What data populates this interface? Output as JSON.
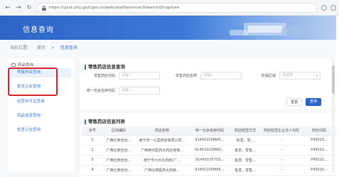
{
  "browser": {
    "url": "https://yjxxt.yfyj.gxzf.gov.cn/web/nbxtPalomcar/Vsearch/Drugstore"
  },
  "banner": {
    "title": "信息查询"
  },
  "breadcrumb": {
    "label": "当前位置：",
    "home": "首页",
    "current": "信息查询"
  },
  "sidebar": {
    "group": "药品查询",
    "items": [
      {
        "label": "零售药店查询"
      },
      {
        "label": "批发企业查询"
      },
      {
        "label": "经营许可证查询"
      },
      {
        "label": "药品信息查询"
      },
      {
        "label": "检查公告查询"
      }
    ]
  },
  "query": {
    "title": "零售药店信息查询",
    "fields": {
      "store_code": {
        "label": "零售药店代码",
        "placeholder": "请输入"
      },
      "store_name": {
        "label": "零售药店名称",
        "placeholder": "请输入"
      },
      "region": {
        "label": "所属区域",
        "placeholder": "请选择"
      },
      "credit_code": {
        "label": "统一社会信用代码",
        "placeholder": "请输入"
      }
    },
    "reset_label": "重置",
    "search_label": "查询"
  },
  "results": {
    "title": "零售药店信息列表",
    "columns": [
      "序号",
      "区划编码",
      "药店名称",
      "统一社会信用代码",
      "药店经营方式",
      "药店经营企业法人代码",
      "药店代码"
    ],
    "rows": [
      [
        "1",
        "广西壮族自治...",
        "南宁市一心堂药店有限公司...",
        "91450100MA5...",
        "批发、零...",
        "-",
        "P45010..."
      ],
      [
        "2",
        "广西壮族自治...",
        "广西柳州医药大药店连锁...",
        "91450102MAD...",
        "批发、零售...",
        "-",
        "P45010..."
      ],
      [
        "3",
        "广西壮族自治...",
        "南宁市九州大药房(广...",
        "91450105703...",
        "批发、零售...",
        "-",
        "P45010..."
      ],
      [
        "4",
        "广西壮族自治...",
        "广西壮族医药大药房...",
        "91450105MA5...",
        "批发、零售...",
        "-",
        "P45010..."
      ]
    ]
  }
}
